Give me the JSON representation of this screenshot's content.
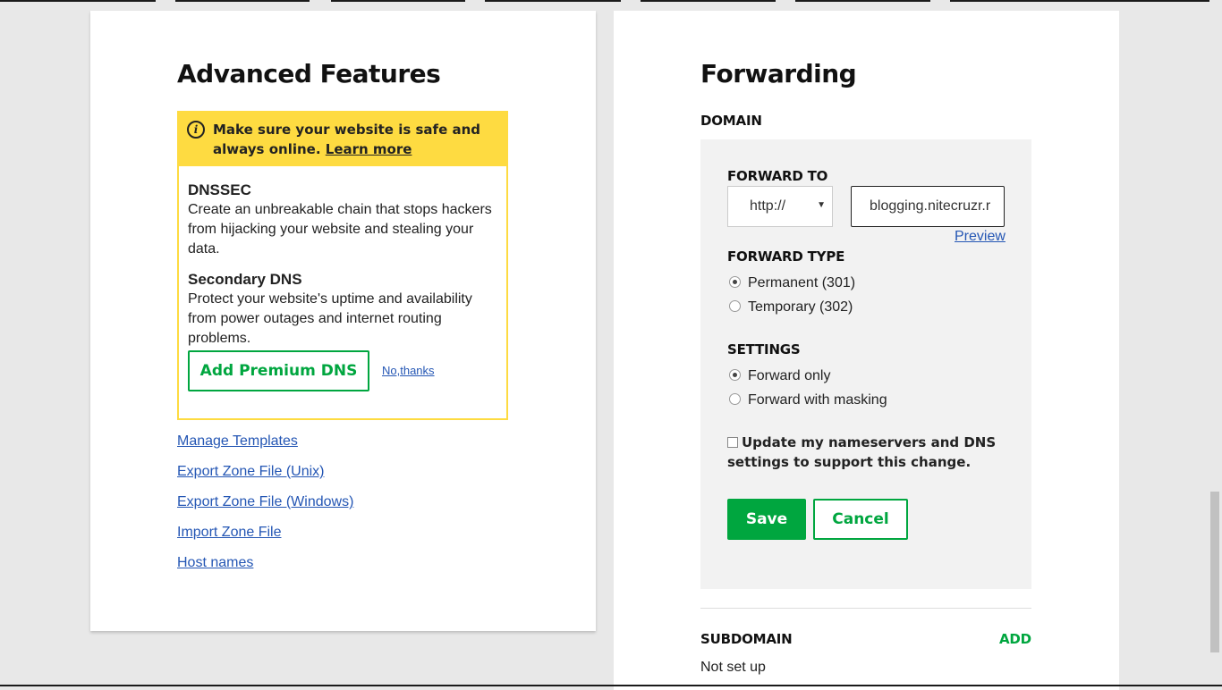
{
  "advanced": {
    "title": "Advanced Features",
    "alert": {
      "text": "Make sure your website is safe and always online.",
      "link": "Learn more"
    },
    "features": [
      {
        "title": "DNSSEC",
        "desc": "Create an unbreakable chain that stops hackers from hijacking your website and stealing your data."
      },
      {
        "title": "Secondary DNS",
        "desc": "Protect your website's uptime and availability from power outages and internet routing problems."
      }
    ],
    "add_button": "Add Premium DNS",
    "decline": "No,thanks",
    "links": [
      "Manage Templates",
      "Export Zone File (Unix)",
      "Export Zone File (Windows)",
      "Import Zone File",
      "Host names"
    ]
  },
  "forwarding": {
    "title": "Forwarding",
    "domain_label": "DOMAIN",
    "forward_to_label": "FORWARD TO",
    "protocol": "http://",
    "destination": "blogging.nitecruzr.r",
    "preview": "Preview",
    "forward_type_label": "FORWARD TYPE",
    "forward_types": [
      {
        "label": "Permanent (301)",
        "selected": true
      },
      {
        "label": "Temporary (302)",
        "selected": false
      }
    ],
    "settings_label": "SETTINGS",
    "settings": [
      {
        "label": "Forward only",
        "selected": true
      },
      {
        "label": "Forward with masking",
        "selected": false
      }
    ],
    "nameserver_checkbox": "Update my nameservers and DNS settings to support this change.",
    "save": "Save",
    "cancel": "Cancel",
    "subdomain_label": "SUBDOMAIN",
    "add": "ADD",
    "subdomain_value": "Not set up"
  },
  "colors": {
    "accent_green": "#00a63f",
    "alert_yellow": "#fedb41",
    "link_blue": "#2456b4"
  }
}
